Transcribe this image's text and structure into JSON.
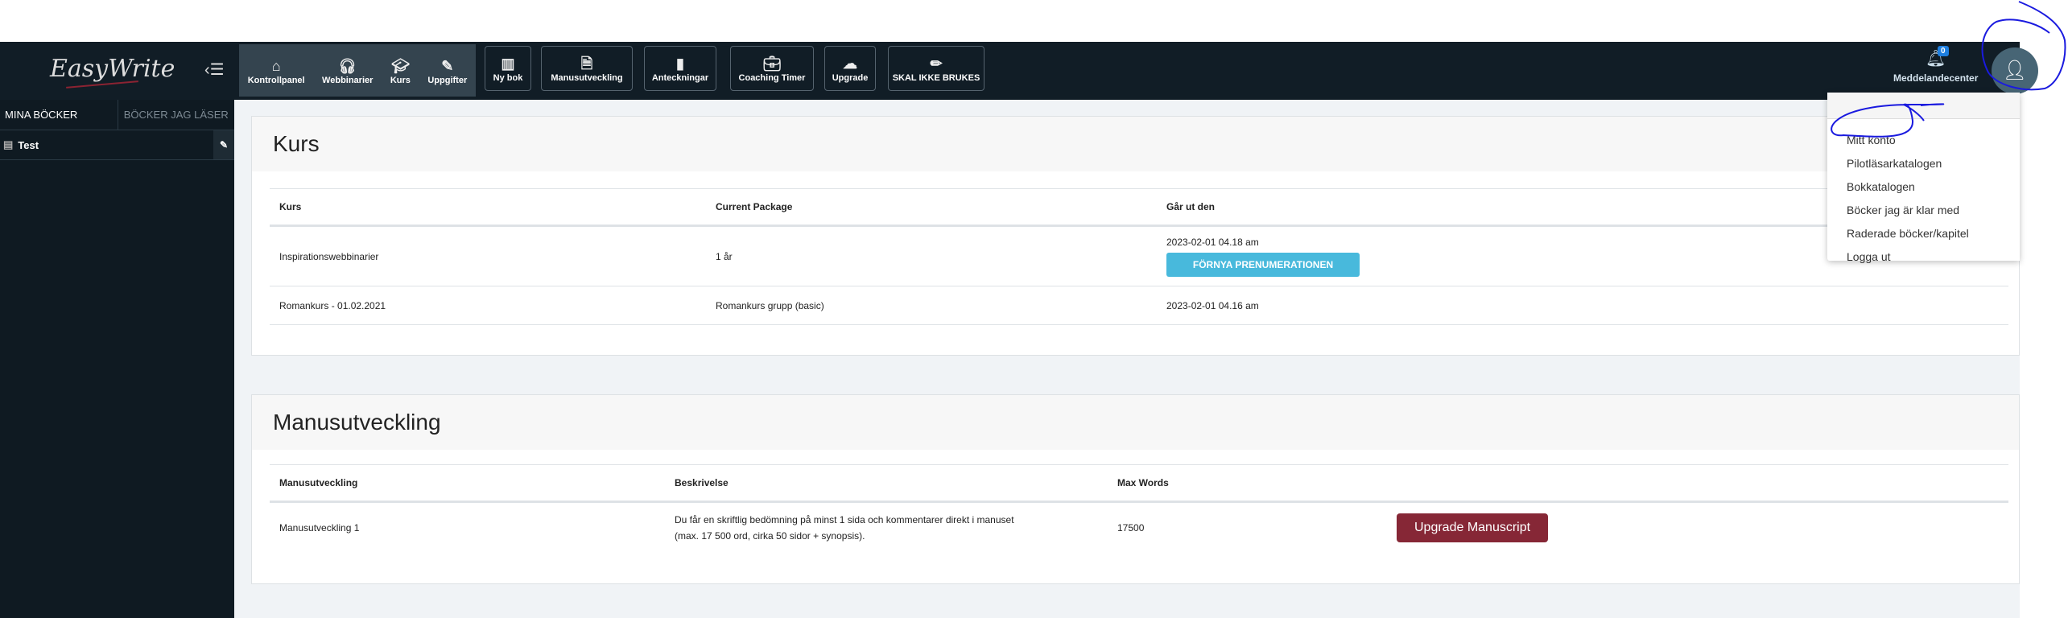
{
  "brand": {
    "logo_text": "EasyWrite"
  },
  "nav": {
    "group": [
      {
        "label": "Kontrollpanel",
        "icon": "home-icon"
      },
      {
        "label": "Webbinarier",
        "icon": "headset-icon"
      },
      {
        "label": "Kurs",
        "icon": "graduation-cap-icon"
      },
      {
        "label": "Uppgifter",
        "icon": "pen-document-icon"
      }
    ],
    "buttons": [
      {
        "label": "Ny bok",
        "icon": "book-icon"
      },
      {
        "label": "Manusutveckling",
        "icon": "word-file-icon"
      },
      {
        "label": "Anteckningar",
        "icon": "note-icon"
      },
      {
        "label": "Coaching Timer",
        "icon": "briefcase-clock-icon"
      },
      {
        "label": "Upgrade",
        "icon": "cloud-upload-icon"
      },
      {
        "label": "SKAL IKKE BRUKES",
        "icon": "pencil-icon"
      }
    ],
    "notification_count": "0",
    "notifications_label": "Meddelandecenter"
  },
  "sidebar": {
    "tabs": [
      "MINA BÖCKER",
      "BÖCKER JAG LÄSER"
    ],
    "books": [
      "Test"
    ]
  },
  "kurs": {
    "title": "Kurs",
    "headers": [
      "Kurs",
      "Current Package",
      "Går ut den"
    ],
    "rows": [
      {
        "kurs": "Inspirationswebbinarier",
        "package": "1 år",
        "expires": "2023-02-01 04.18 am",
        "action": "FÖRNYA PRENUMERATIONEN"
      },
      {
        "kurs": "Romankurs - 01.02.2021",
        "package": "Romankurs grupp (basic)",
        "expires": "2023-02-01 04.16 am"
      }
    ]
  },
  "manus": {
    "title": "Manusutveckling",
    "headers": [
      "Manusutveckling",
      "Beskrivelse",
      "Max Words"
    ],
    "rows": [
      {
        "name": "Manusutveckling 1",
        "desc1": "Du får en skriftlig bedömning på minst 1 sida och kommentarer direkt i manuset",
        "desc2": "(max. 17 500 ord, cirka 50 sidor + synopsis).",
        "max": "17500",
        "action": "Upgrade Manuscript"
      }
    ]
  },
  "menu": [
    "Mitt konto",
    "Pilotläsarkatalogen",
    "Bokkatalogen",
    "Böcker jag är klar med",
    "Raderade böcker/kapitel",
    "Logga ut"
  ],
  "colors": {
    "nav": "#111d26",
    "renew": "#48b9dc",
    "upgrade": "#862736",
    "annotation": "#1a1adf"
  }
}
